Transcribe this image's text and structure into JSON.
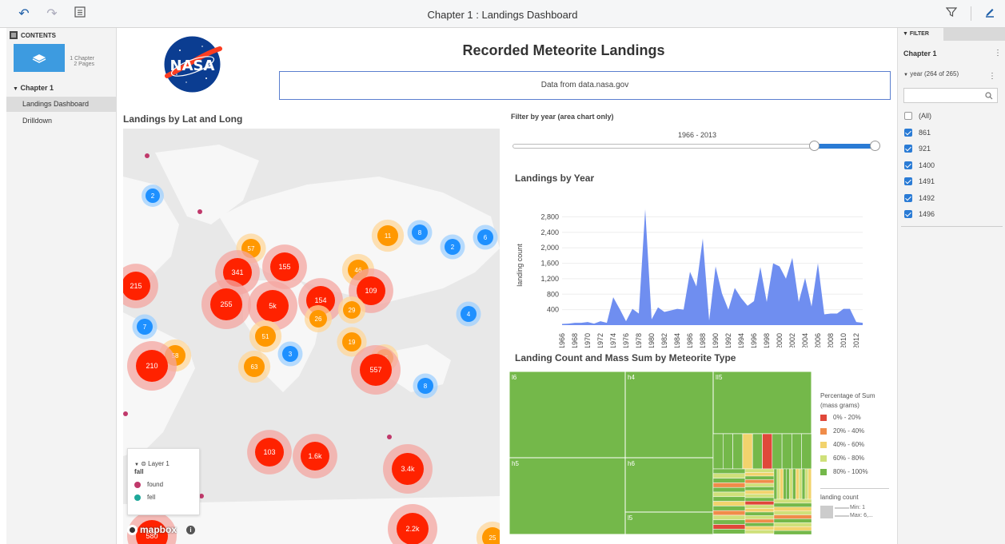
{
  "toolbar": {
    "title": "Chapter 1 : Landings Dashboard"
  },
  "left": {
    "contents_label": "CONTENTS",
    "chapters_count": "1 Chapter",
    "pages_count": "2 Pages",
    "chapter": "Chapter 1",
    "pages": [
      "Landings Dashboard",
      "Drilldown"
    ]
  },
  "right": {
    "filter_label": "FILTER",
    "chapter": "Chapter 1",
    "field": "year (264 of 265)",
    "items": [
      {
        "label": "(All)",
        "checked": false
      },
      {
        "label": "861",
        "checked": true
      },
      {
        "label": "921",
        "checked": true
      },
      {
        "label": "1400",
        "checked": true
      },
      {
        "label": "1491",
        "checked": true
      },
      {
        "label": "1492",
        "checked": true
      },
      {
        "label": "1496",
        "checked": true
      }
    ]
  },
  "header": {
    "logo_text": "NASA",
    "title": "Recorded Meteorite Landings",
    "subtitle": "Data from data.nasa.gov"
  },
  "map": {
    "title": "Landings by Lat and Long",
    "attribution": "mapbox",
    "clusters": [
      {
        "label": "2",
        "kind": "blue"
      },
      {
        "label": "57",
        "kind": "orange"
      },
      {
        "label": "341",
        "kind": "red"
      },
      {
        "label": "155",
        "kind": "red"
      },
      {
        "label": "11",
        "kind": "orange"
      },
      {
        "label": "8",
        "kind": "blue"
      },
      {
        "label": "2",
        "kind": "blue"
      },
      {
        "label": "6",
        "kind": "blue"
      },
      {
        "label": "46",
        "kind": "orange"
      },
      {
        "label": "215",
        "kind": "red"
      },
      {
        "label": "255",
        "kind": "red"
      },
      {
        "label": "5k",
        "kind": "red"
      },
      {
        "label": "154",
        "kind": "red"
      },
      {
        "label": "109",
        "kind": "red"
      },
      {
        "label": "29",
        "kind": "orange"
      },
      {
        "label": "26",
        "kind": "orange"
      },
      {
        "label": "4",
        "kind": "blue"
      },
      {
        "label": "7",
        "kind": "blue"
      },
      {
        "label": "51",
        "kind": "orange"
      },
      {
        "label": "19",
        "kind": "orange"
      },
      {
        "label": "3",
        "kind": "blue"
      },
      {
        "label": "58",
        "kind": "orange"
      },
      {
        "label": "210",
        "kind": "red"
      },
      {
        "label": "63",
        "kind": "orange"
      },
      {
        "label": "25",
        "kind": "orange"
      },
      {
        "label": "557",
        "kind": "red"
      },
      {
        "label": "8",
        "kind": "blue"
      },
      {
        "label": "103",
        "kind": "red"
      },
      {
        "label": "1.6k",
        "kind": "red"
      },
      {
        "label": "3.4k",
        "kind": "red"
      },
      {
        "label": "2.2k",
        "kind": "red"
      },
      {
        "label": "580",
        "kind": "red"
      },
      {
        "label": "25",
        "kind": "orange"
      }
    ],
    "legend": {
      "layer": "Layer 1",
      "field": "fall",
      "items": [
        {
          "label": "found",
          "color": "#c0396b"
        },
        {
          "label": "fell",
          "color": "#1ea89a"
        }
      ]
    }
  },
  "slider": {
    "title": "Filter by year (area chart only)",
    "range": "1966 - 2013",
    "low_fraction": 0.82,
    "high_fraction": 1.0
  },
  "chart_data": [
    {
      "type": "area",
      "title": "Landings by Year",
      "xlabel": "year",
      "ylabel": "landing count",
      "x": [
        1966,
        1967,
        1968,
        1969,
        1970,
        1971,
        1972,
        1973,
        1974,
        1975,
        1976,
        1977,
        1978,
        1979,
        1980,
        1981,
        1982,
        1983,
        1984,
        1985,
        1986,
        1987,
        1988,
        1989,
        1990,
        1991,
        1992,
        1993,
        1994,
        1995,
        1996,
        1997,
        1998,
        1999,
        2000,
        2001,
        2002,
        2003,
        2004,
        2005,
        2006,
        2007,
        2008,
        2009,
        2010,
        2011,
        2012,
        2013
      ],
      "y": [
        30,
        40,
        60,
        60,
        80,
        40,
        100,
        60,
        720,
        420,
        100,
        420,
        300,
        3000,
        150,
        460,
        340,
        380,
        420,
        400,
        1380,
        1000,
        2240,
        120,
        1520,
        820,
        400,
        960,
        700,
        500,
        620,
        1500,
        600,
        1600,
        1520,
        1200,
        1740,
        600,
        1220,
        480,
        1600,
        280,
        300,
        300,
        420,
        420,
        80,
        60
      ],
      "yticks": [
        400,
        800,
        1200,
        1600,
        2000,
        2400,
        2800
      ],
      "ylim": [
        0,
        3100
      ],
      "xticks": [
        "1966",
        "1968",
        "1970",
        "1972",
        "1974",
        "1976",
        "1978",
        "1980",
        "1982",
        "1984",
        "1986",
        "1988",
        "1990",
        "1992",
        "1994",
        "1996",
        "1998",
        "2000",
        "2002",
        "2004",
        "2006",
        "2008",
        "2010",
        "2012"
      ],
      "color": "#6f8ef0"
    },
    {
      "type": "heatmap",
      "title": "Landing Count and Mass Sum by Meteorite Type",
      "cells": [
        {
          "label": "l6"
        },
        {
          "label": "h4"
        },
        {
          "label": "lI5"
        },
        {
          "label": "h6"
        },
        {
          "label": "h5"
        },
        {
          "label": "l5"
        }
      ],
      "legend_title": "Percentage of Sum (mass grams)",
      "legend": [
        {
          "label": "0% - 20%",
          "color": "#e0483a"
        },
        {
          "label": "20% - 40%",
          "color": "#f08c4a"
        },
        {
          "label": "40% - 60%",
          "color": "#f2d36d"
        },
        {
          "label": "60% - 80%",
          "color": "#cfe07a"
        },
        {
          "label": "80% - 100%",
          "color": "#74b84a"
        }
      ],
      "size_legend": {
        "title": "landing count",
        "min": "Min: 1",
        "max": "Max: 6,..."
      }
    }
  ]
}
